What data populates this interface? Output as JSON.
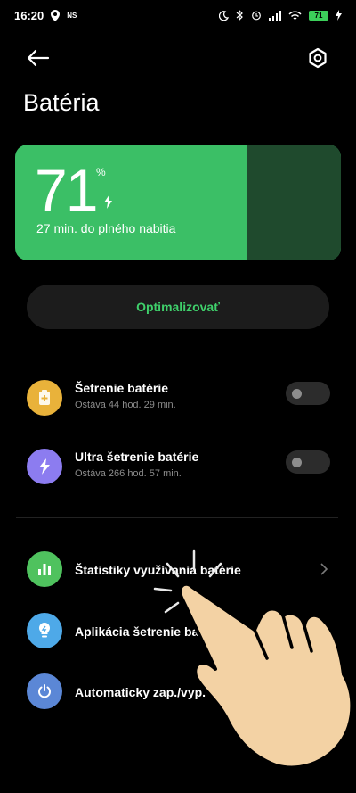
{
  "status_bar": {
    "time": "16:20",
    "ns": "NS",
    "battery": "71",
    "icons": [
      "location-icon",
      "moon-icon",
      "bluetooth-icon",
      "alarm-icon",
      "signal-icon",
      "wifi-icon",
      "battery-icon",
      "charging-icon"
    ]
  },
  "header": {
    "title": "Batéria"
  },
  "battery_card": {
    "level": "71",
    "percent": "%",
    "charge_status": "27 min. do plného nabitia",
    "level_fraction": 0.71,
    "fill_color": "#3bbf66",
    "remainder_color": "#1f4a2d"
  },
  "optimize": {
    "label": "Optimalizovať",
    "color": "#3fd06b"
  },
  "modes": [
    {
      "title": "Šetrenie batérie",
      "subtitle": "Ostáva 44 hod. 29 min.",
      "icon": "battery-saver-icon",
      "icon_color": "#e9b23a",
      "enabled": false
    },
    {
      "title": "Ultra šetrenie batérie",
      "subtitle": "Ostáva 266 hod. 57 min.",
      "icon": "bolt-icon",
      "icon_color": "#8c7cf0",
      "enabled": false
    }
  ],
  "menu": [
    {
      "title": "Štatistiky využívania batérie",
      "icon": "bar-chart-icon",
      "icon_color": "#4fc25e"
    },
    {
      "title": "Aplikácia šetrenie ba",
      "icon": "lightbulb-icon",
      "icon_color": "#4ea9e8"
    },
    {
      "title": "Automaticky zap./vyp.",
      "icon": "power-icon",
      "icon_color": "#5b87d6"
    }
  ]
}
